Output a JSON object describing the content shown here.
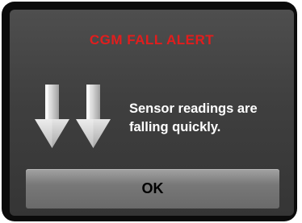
{
  "alert": {
    "title": "CGM FALL ALERT",
    "title_color": "#e21d1d",
    "icon": "double-down-arrow-icon",
    "message_line1": "Sensor readings are",
    "message_line2": "falling quickly."
  },
  "actions": {
    "ok_label": "OK"
  }
}
